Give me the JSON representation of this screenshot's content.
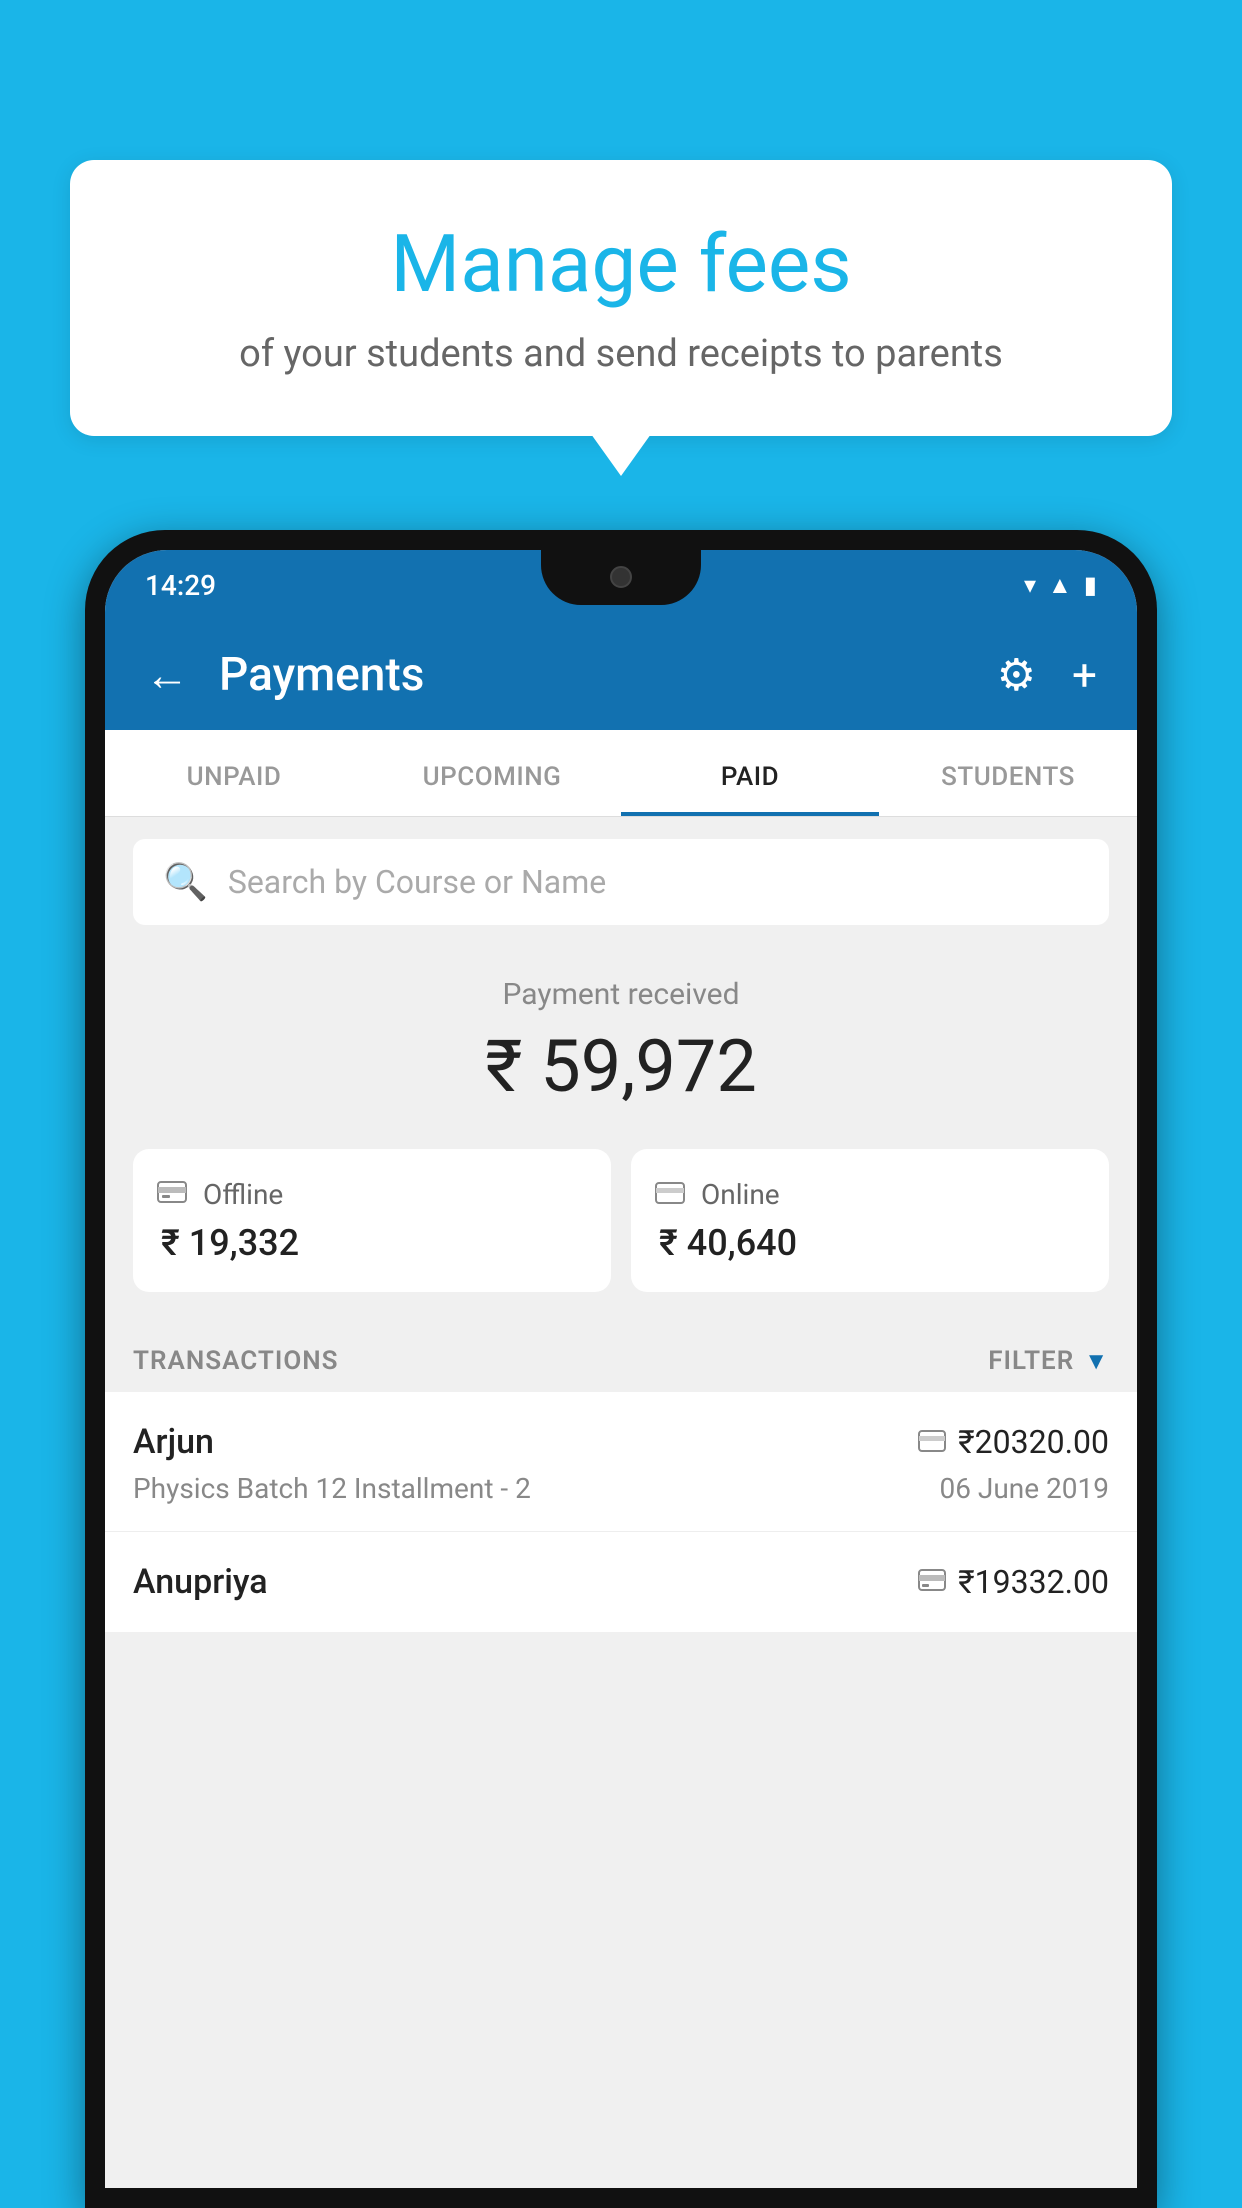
{
  "background_color": "#1ab5e8",
  "bubble": {
    "title": "Manage fees",
    "subtitle": "of your students and send receipts to parents"
  },
  "phone": {
    "status": {
      "time": "14:29",
      "icons": [
        "▲",
        "▲",
        "▮"
      ]
    },
    "app_bar": {
      "title": "Payments",
      "back_label": "←",
      "gear_label": "⚙",
      "plus_label": "+"
    },
    "tabs": [
      {
        "label": "UNPAID",
        "active": false
      },
      {
        "label": "UPCOMING",
        "active": false
      },
      {
        "label": "PAID",
        "active": true
      },
      {
        "label": "STUDENTS",
        "active": false
      }
    ],
    "search": {
      "placeholder": "Search by Course or Name"
    },
    "payment_received": {
      "label": "Payment received",
      "amount": "₹ 59,972"
    },
    "cards": [
      {
        "type": "offline",
        "label": "Offline",
        "amount": "₹ 19,332",
        "icon": "💳"
      },
      {
        "type": "online",
        "label": "Online",
        "amount": "₹ 40,640",
        "icon": "💳"
      }
    ],
    "transactions_label": "TRANSACTIONS",
    "filter_label": "FILTER",
    "transactions": [
      {
        "name": "Arjun",
        "amount": "₹20320.00",
        "course": "Physics Batch 12 Installment - 2",
        "date": "06 June 2019",
        "payment_type": "online"
      },
      {
        "name": "Anupriya",
        "amount": "₹19332.00",
        "course": "",
        "date": "",
        "payment_type": "offline"
      }
    ]
  }
}
